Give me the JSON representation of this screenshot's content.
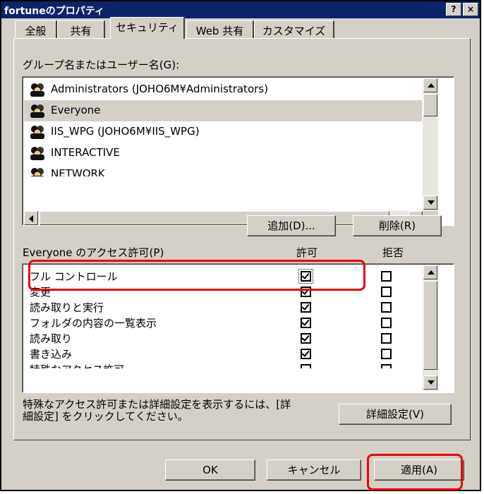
{
  "window": {
    "title": "fortuneのプロパティ",
    "help_label": "?",
    "close_label": "×"
  },
  "tabs": [
    {
      "label": "全般",
      "active": false
    },
    {
      "label": "共有",
      "active": false
    },
    {
      "label": "セキュリティ",
      "active": true
    },
    {
      "label": "Web 共有",
      "active": false
    },
    {
      "label": "カスタマイズ",
      "active": false
    }
  ],
  "groups": {
    "label": "グループ名またはユーザー名(G):",
    "items": [
      {
        "name": "Administrators (JOHO6M¥Administrators)",
        "selected": false
      },
      {
        "name": "Everyone",
        "selected": true
      },
      {
        "name": "IIS_WPG (JOHO6M¥IIS_WPG)",
        "selected": false
      },
      {
        "name": "INTERACTIVE",
        "selected": false
      },
      {
        "name": "NETWORK",
        "selected": false
      }
    ],
    "add_label": "追加(D)...",
    "remove_label": "削除(R)"
  },
  "permissions": {
    "label": "Everyone のアクセス許可(P)",
    "allow_header": "許可",
    "deny_header": "拒否",
    "items": [
      {
        "name": "フル コントロール",
        "allow": true,
        "deny": false
      },
      {
        "name": "変更",
        "allow": true,
        "deny": false
      },
      {
        "name": "読み取りと実行",
        "allow": true,
        "deny": false
      },
      {
        "name": "フォルダの内容の一覧表示",
        "allow": true,
        "deny": false
      },
      {
        "name": "読み取り",
        "allow": true,
        "deny": false
      },
      {
        "name": "書き込み",
        "allow": true,
        "deny": false
      },
      {
        "name": "特殊なアクセス許可",
        "allow": false,
        "deny": false
      }
    ]
  },
  "advanced": {
    "text_line1": "特殊なアクセス許可または詳細設定を表示するには、[詳",
    "text_line2": "細設定] をクリックしてください。",
    "button_label": "詳細設定(V)"
  },
  "footer": {
    "ok_label": "OK",
    "cancel_label": "キャンセル",
    "apply_label": "適用(A)"
  },
  "colors": {
    "highlight": "#e8000b",
    "titlebar": "#0a246a",
    "face": "#d4d0c8"
  }
}
